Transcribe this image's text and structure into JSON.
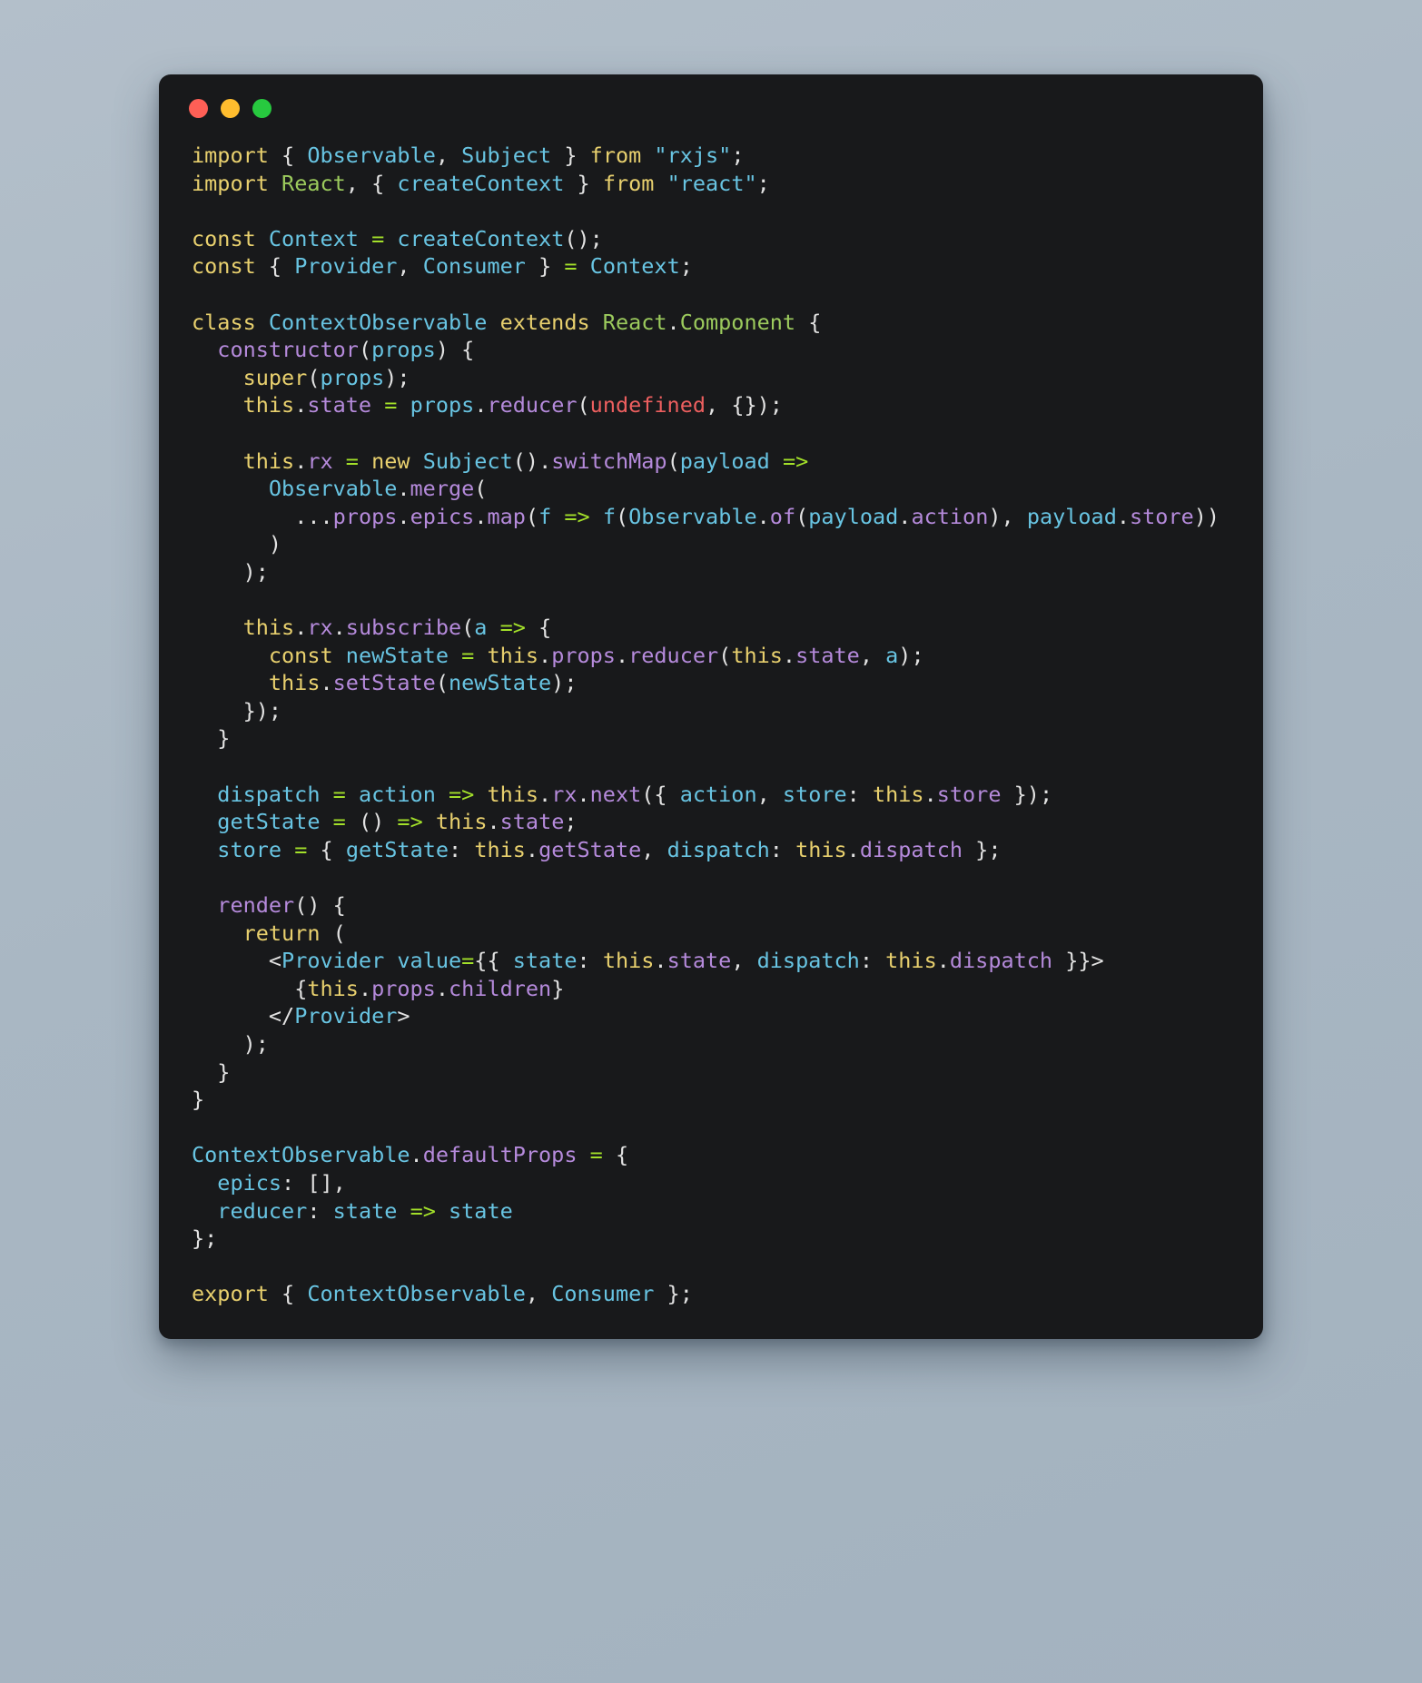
{
  "window": {
    "traffic_lights": [
      {
        "name": "close",
        "color": "#ff5f56"
      },
      {
        "name": "minimize",
        "color": "#ffbd2e"
      },
      {
        "name": "zoom",
        "color": "#27c93f"
      }
    ],
    "background": "#18191b",
    "page_background": "#adbac6"
  },
  "theme": {
    "keyword": "#e8d06e",
    "identifier": "#68c4e2",
    "string": "#68c4e2",
    "property": "#b58adb",
    "operator": "#a3e02a",
    "punctuation": "#e2e2e2",
    "literal": "#ed5f5f",
    "class_member": "#9ccb5d"
  },
  "code": {
    "language": "javascript",
    "lines": [
      "import { Observable, Subject } from \"rxjs\";",
      "import React, { createContext } from \"react\";",
      "",
      "const Context = createContext();",
      "const { Provider, Consumer } = Context;",
      "",
      "class ContextObservable extends React.Component {",
      "  constructor(props) {",
      "    super(props);",
      "    this.state = props.reducer(undefined, {});",
      "",
      "    this.rx = new Subject().switchMap(payload =>",
      "      Observable.merge(",
      "        ...props.epics.map(f => f(Observable.of(payload.action), payload.store))",
      "      )",
      "    );",
      "",
      "    this.rx.subscribe(a => {",
      "      const newState = this.props.reducer(this.state, a);",
      "      this.setState(newState);",
      "    });",
      "  }",
      "",
      "  dispatch = action => this.rx.next({ action, store: this.store });",
      "  getState = () => this.state;",
      "  store = { getState: this.getState, dispatch: this.dispatch };",
      "",
      "  render() {",
      "    return (",
      "      <Provider value={{ state: this.state, dispatch: this.dispatch }}>",
      "        {this.props.children}",
      "      </Provider>",
      "    );",
      "  }",
      "}",
      "",
      "ContextObservable.defaultProps = {",
      "  epics: [],",
      "  reducer: state => state",
      "};",
      "",
      "export { ContextObservable, Consumer };"
    ]
  }
}
